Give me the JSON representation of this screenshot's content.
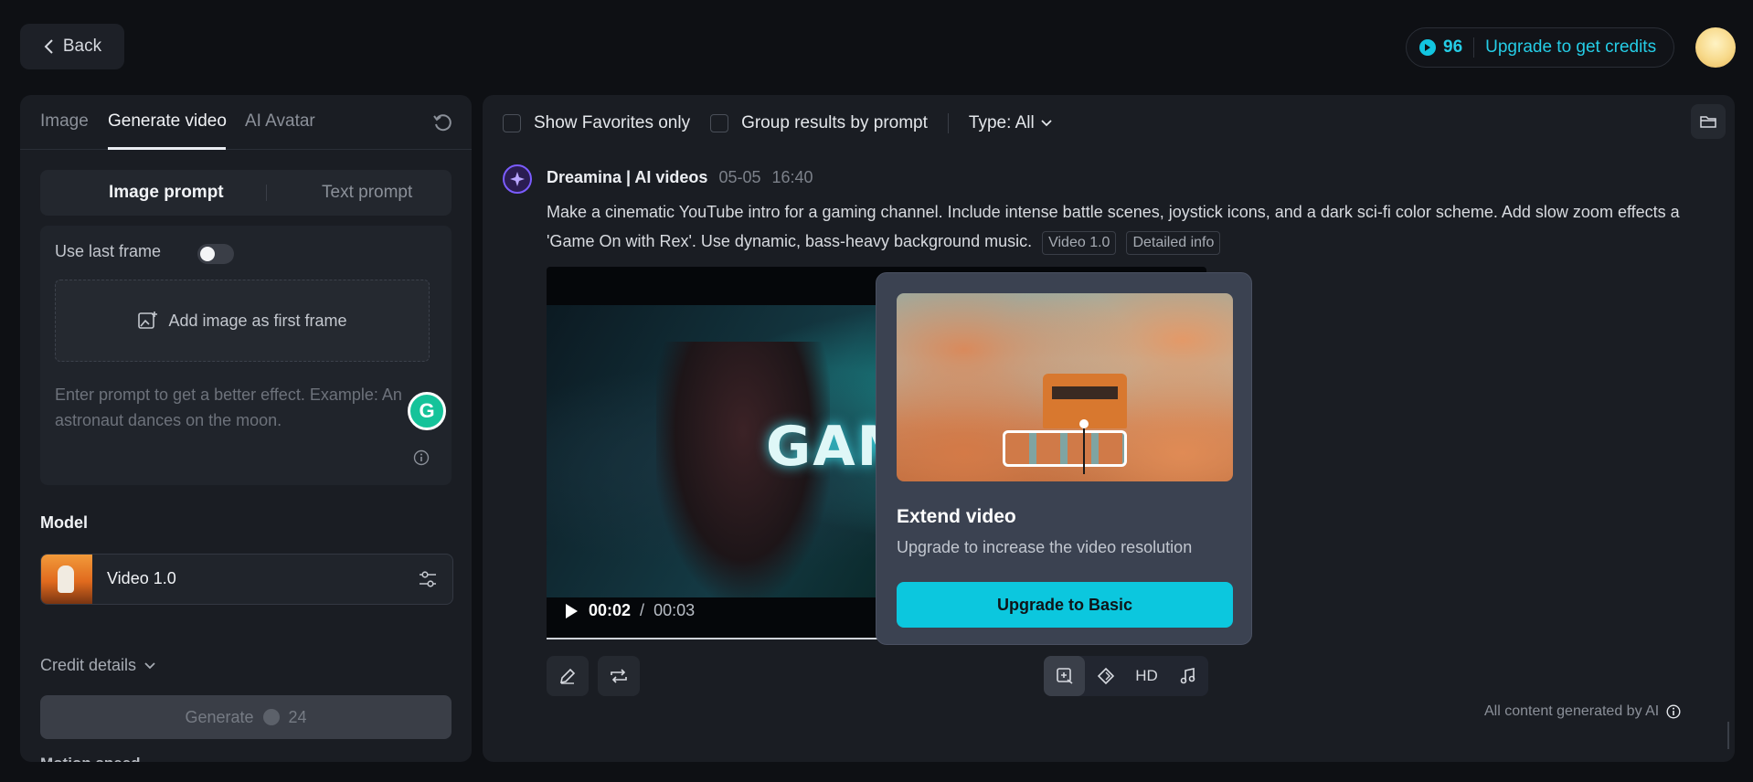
{
  "header": {
    "back_label": "Back",
    "credits_count": "96",
    "upgrade_label": "Upgrade to get credits"
  },
  "left_panel": {
    "tabs": [
      {
        "label": "Image"
      },
      {
        "label": "Generate video"
      },
      {
        "label": "AI Avatar"
      }
    ],
    "active_tab": "Generate video",
    "prompt_modes": {
      "image": "Image prompt",
      "text": "Text prompt"
    },
    "active_prompt_mode": "Image prompt",
    "use_last_frame_label": "Use last frame",
    "use_last_frame_enabled": false,
    "add_image_label": "Add image as first frame",
    "prompt_placeholder": "Enter prompt to get a better effect. Example: An astronaut dances on the moon.",
    "model_label": "Model",
    "model_name": "Video 1.0",
    "credit_details_label": "Credit details",
    "generate_label": "Generate",
    "generate_cost": "24",
    "cut_off_text": "Motion speed"
  },
  "main": {
    "filters": {
      "favorites_label": "Show Favorites only",
      "group_label": "Group results by prompt",
      "type_label": "Type: All"
    },
    "message": {
      "author": "Dreamina | AI videos",
      "date": "05-05",
      "time": "16:40",
      "text_line1": "Make a cinematic YouTube intro for a gaming channel. Include intense battle scenes, joystick icons, and a dark sci-fi color scheme. Add slow zoom effects a",
      "text_line2": "'Game On with Rex'. Use dynamic, bass-heavy background music.",
      "tag_model": "Video 1.0",
      "tag_info": "Detailed info"
    },
    "video": {
      "neon_text": "GAME",
      "current_time": "00:02",
      "duration": "00:03",
      "progress": 0.67
    },
    "toolbar": {
      "hd_label": "HD"
    },
    "disclaimer": "All content generated by AI"
  },
  "popup": {
    "title": "Extend video",
    "description": "Upgrade to increase the video resolution",
    "cta_label": "Upgrade to Basic"
  },
  "colors": {
    "accent": "#0cc7de",
    "background": "#0e1014",
    "panel": "#1a1d23"
  }
}
